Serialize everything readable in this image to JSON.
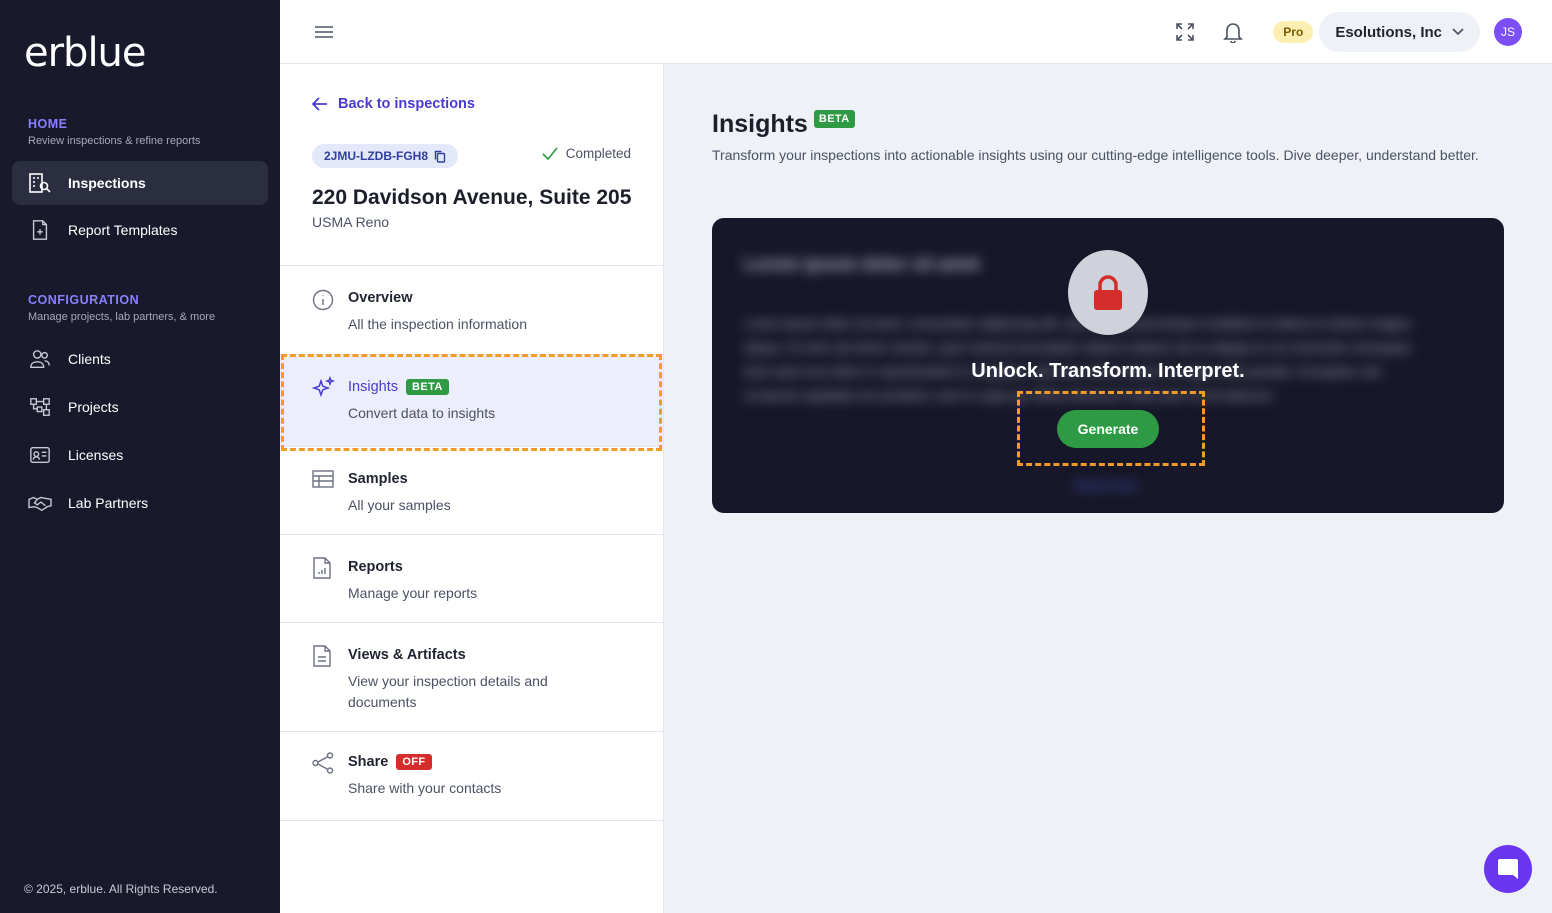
{
  "sidebar": {
    "logo": "erblue",
    "home": {
      "title": "HOME",
      "subtitle": "Review inspections & refine reports"
    },
    "home_items": [
      {
        "label": "Inspections",
        "icon": "buildings-search-icon"
      },
      {
        "label": "Report Templates",
        "icon": "file-plus-icon"
      }
    ],
    "config": {
      "title": "CONFIGURATION",
      "subtitle": "Manage projects, lab partners, & more"
    },
    "config_items": [
      {
        "label": "Clients",
        "icon": "users-icon"
      },
      {
        "label": "Projects",
        "icon": "hierarchy-icon"
      },
      {
        "label": "Licenses",
        "icon": "id-card-icon"
      },
      {
        "label": "Lab Partners",
        "icon": "handshake-icon"
      }
    ],
    "copyright": "© 2025, erblue. All Rights Reserved."
  },
  "topbar": {
    "pro_label": "Pro",
    "org_name": "Esolutions, Inc",
    "avatar_initials": "JS"
  },
  "inspection": {
    "back_label": "Back to inspections",
    "id": "2JMU-LZDB-FGH8",
    "status": "Completed",
    "address": "220 Davidson Avenue, Suite 205",
    "site": "USMA Reno"
  },
  "menu": [
    {
      "title": "Overview",
      "desc": "All the inspection information",
      "icon": "info-icon"
    },
    {
      "title": "Insights",
      "desc": "Convert data to insights",
      "badge": "BETA",
      "icon": "sparkles-icon"
    },
    {
      "title": "Samples",
      "desc": "All your samples",
      "icon": "table-icon"
    },
    {
      "title": "Reports",
      "desc": "Manage your reports",
      "icon": "report-chart-icon"
    },
    {
      "title": "Views & Artifacts",
      "desc": "View your inspection details and documents",
      "icon": "document-icon"
    },
    {
      "title": "Share",
      "desc": "Share with your contacts",
      "badge": "OFF",
      "icon": "share-icon"
    }
  ],
  "main": {
    "title": "Insights",
    "badge": "BETA",
    "description": "Transform your inspections into actionable insights using our cutting-edge intelligence tools. Dive deeper, understand better.",
    "card": {
      "blur_heading": "Lorem ipsum dolor sit amet",
      "blur_line1": "Lorem ipsum dolor sit amet, consectetur adipiscing elit, sed do eiusmod tempor incididunt ut labore et dolore magna",
      "blur_line2": "aliqua. Ut enim ad minim veniam, quis nostrud exercitation ullamco laboris nisi ut aliquip ex ea commodo consequat.",
      "blur_line3": "Duis aute irure dolor in reprehenderit in voluptate velit esse cillum dolore eu fugiat nulla pariatur. Excepteur sint",
      "blur_line4": "occaecat cupidatat non proident, sunt in culpa qui officia deserunt mollit anim id est laborum.",
      "blur_link": "Read more",
      "headline": "Unlock. Transform. Interpret.",
      "button": "Generate"
    }
  }
}
